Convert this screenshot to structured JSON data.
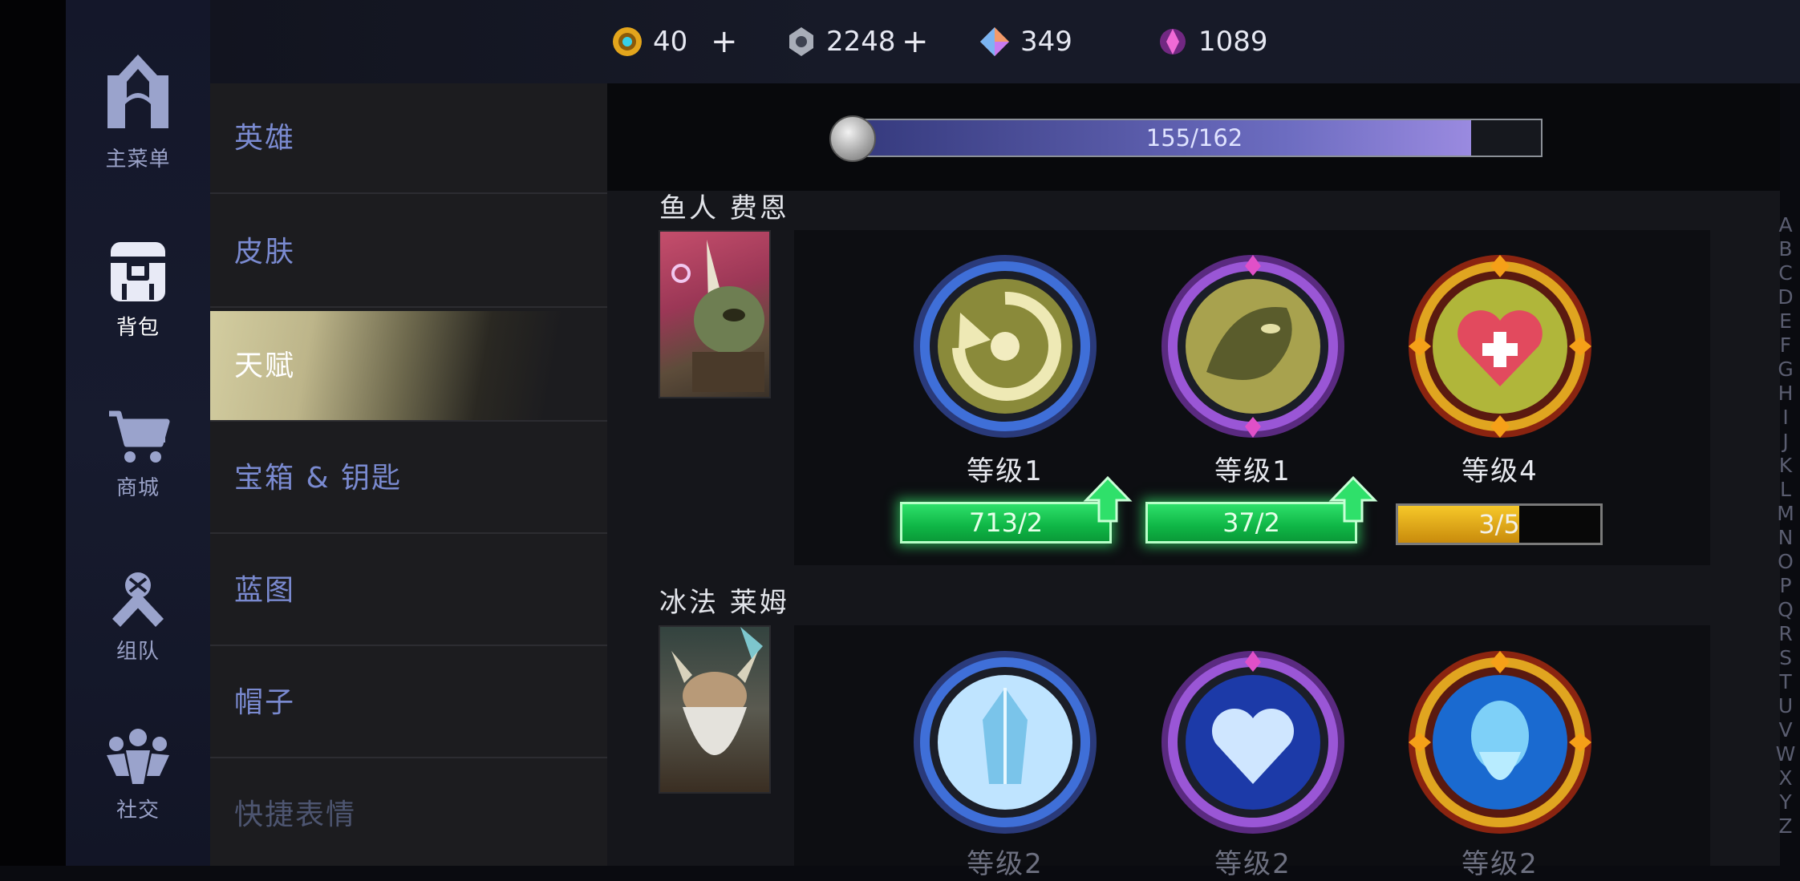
{
  "rail": {
    "items": [
      {
        "label": "主菜单",
        "icon": "main-menu-icon"
      },
      {
        "label": "背包",
        "icon": "backpack-icon",
        "active": true
      },
      {
        "label": "商城",
        "icon": "shop-cart-icon"
      },
      {
        "label": "组队",
        "icon": "team-handshake-icon"
      },
      {
        "label": "社交",
        "icon": "social-people-icon"
      }
    ]
  },
  "categories": {
    "items": [
      {
        "label": "英雄"
      },
      {
        "label": "皮肤"
      },
      {
        "label": "天赋",
        "active": true
      },
      {
        "label": "宝箱 & 钥匙"
      },
      {
        "label": "蓝图"
      },
      {
        "label": "帽子"
      },
      {
        "label": "快捷表情"
      }
    ]
  },
  "currencies": [
    {
      "icon": "gold-coin-icon",
      "value": "40",
      "has_plus": true
    },
    {
      "icon": "silver-shard-icon",
      "value": "2248",
      "has_plus": true
    },
    {
      "icon": "prism-gem-icon",
      "value": "349"
    },
    {
      "icon": "pink-crystal-icon",
      "value": "1089"
    }
  ],
  "collection_progress": {
    "text": "155/162",
    "current": 155,
    "total": 162
  },
  "heroes": [
    {
      "name": "鱼人 费恩",
      "talents": [
        {
          "level_label": "等级1",
          "bar_text": "713/2",
          "bar_style": "green",
          "upgradable": true,
          "frame": "blue",
          "icon": "refresh-cycle-icon"
        },
        {
          "level_label": "等级1",
          "bar_text": "37/2",
          "bar_style": "green",
          "upgradable": true,
          "frame": "purple",
          "icon": "fish-creature-icon"
        },
        {
          "level_label": "等级4",
          "bar_text": "3/5",
          "bar_style": "gold",
          "progress": 0.6,
          "upgradable": false,
          "frame": "gold",
          "icon": "heart-heal-icon"
        }
      ]
    },
    {
      "name": "冰法 莱姆",
      "talents": [
        {
          "level_label": "等级2",
          "frame": "blue",
          "icon": "ice-crystal-icon"
        },
        {
          "level_label": "等级2",
          "frame": "purple",
          "icon": "ice-heart-icon"
        },
        {
          "level_label": "等级2",
          "frame": "gold",
          "icon": "ice-sage-icon"
        }
      ]
    }
  ],
  "alphabet": [
    "A",
    "B",
    "C",
    "D",
    "E",
    "F",
    "G",
    "H",
    "I",
    "J",
    "K",
    "L",
    "M",
    "N",
    "O",
    "P",
    "Q",
    "R",
    "S",
    "T",
    "U",
    "V",
    "W",
    "X",
    "Y",
    "Z"
  ],
  "colors": {
    "accent_gold": "#d3cda0",
    "green_bar": "#0fb646",
    "gold_bar": "#f6c829",
    "category_text": "#7a8ad0",
    "frame_blue": "#3f6fd8",
    "frame_purple": "#9a56d6",
    "frame_gold": "#e0a520"
  }
}
